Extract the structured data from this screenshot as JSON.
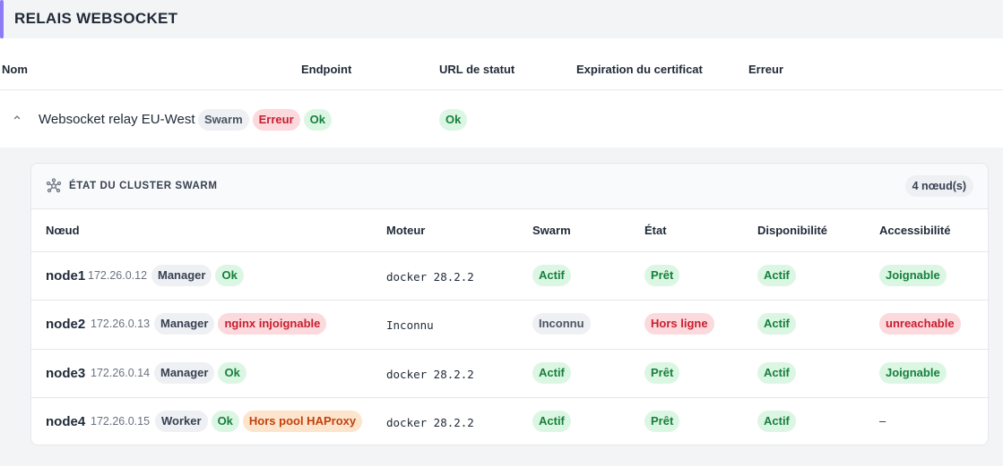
{
  "section": {
    "title": "RELAIS WEBSOCKET"
  },
  "columns": {
    "name": "Nom",
    "endpoint": "Endpoint",
    "status_url": "URL de statut",
    "cert_expiry": "Expiration du certificat",
    "error": "Erreur"
  },
  "relay": {
    "expand_icon": "chevron-up-icon",
    "name": "Websocket relay EU-West",
    "badges": {
      "type": "Swarm",
      "error": "Erreur",
      "ok": "Ok"
    },
    "status_url_badge": "Ok"
  },
  "cluster": {
    "icon": "cluster-network-icon",
    "title": "ÉTAT DU CLUSTER SWARM",
    "count": "4 nœud(s)",
    "headers": {
      "node": "Nœud",
      "engine": "Moteur",
      "swarm": "Swarm",
      "state": "État",
      "availability": "Disponibilité",
      "reachability": "Accessibilité"
    },
    "nodes": [
      {
        "name": "node1",
        "ip": "172.26.0.12",
        "role": "Manager",
        "ok": "Ok",
        "extra": "",
        "engine": "docker 28.2.2",
        "swarm": "Actif",
        "state": "Prêt",
        "availability": "Actif",
        "reachability": "Joignable"
      },
      {
        "name": "node2",
        "ip": "172.26.0.13",
        "role": "Manager",
        "ok": "",
        "extra": "nginx injoignable",
        "engine": "Inconnu",
        "swarm": "Inconnu",
        "state": "Hors ligne",
        "availability": "Actif",
        "reachability": "unreachable"
      },
      {
        "name": "node3",
        "ip": "172.26.0.14",
        "role": "Manager",
        "ok": "Ok",
        "extra": "",
        "engine": "docker 28.2.2",
        "swarm": "Actif",
        "state": "Prêt",
        "availability": "Actif",
        "reachability": "Joignable"
      },
      {
        "name": "node4",
        "ip": "172.26.0.15",
        "role": "Worker",
        "ok": "Ok",
        "extra": "Hors pool HAProxy",
        "engine": "docker 28.2.2",
        "swarm": "Actif",
        "state": "Prêt",
        "availability": "Actif",
        "reachability": "–"
      }
    ]
  },
  "colors": {
    "accent": "#8b7cf6",
    "success_bg": "#dcf6e4",
    "success_fg": "#16803c",
    "danger_bg": "#fbd9dc",
    "danger_fg": "#c81e2f",
    "warning_bg": "#fde4cd",
    "warning_fg": "#c2410c",
    "neutral_bg": "#eef0f4",
    "neutral_fg": "#4b5563"
  }
}
